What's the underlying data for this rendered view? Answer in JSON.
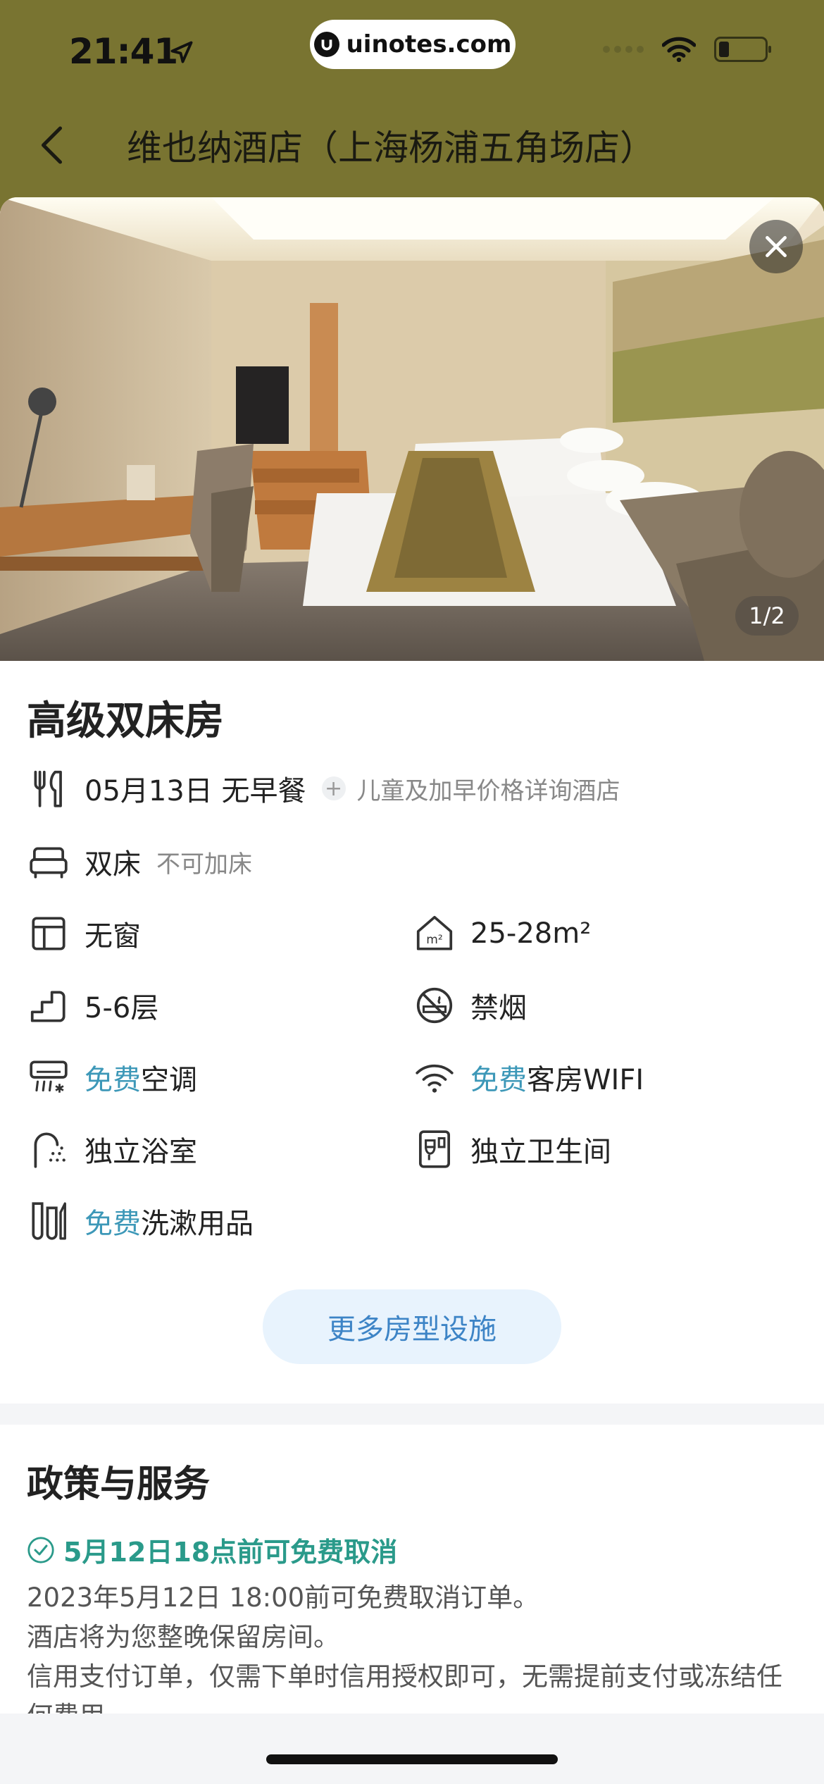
{
  "status_bar": {
    "time": "21:41",
    "url": "uinotes.com"
  },
  "header": {
    "title": "维也纳酒店（上海杨浦五角场店）"
  },
  "photo": {
    "counter": "1/2"
  },
  "room": {
    "name": "高级双床房",
    "meal": {
      "date_meal": "05月13日 无早餐",
      "note": "儿童及加早价格详询酒店"
    },
    "bed": {
      "type": "双床",
      "note": "不可加床"
    },
    "facilities": {
      "window": "无窗",
      "area": "25-28m²",
      "floor": "5-6层",
      "smoking": "禁烟",
      "free_label": "免费",
      "ac": "空调",
      "wifi": "客房WIFI",
      "bathroom": "独立浴室",
      "toilet": "独立卫生间",
      "toiletries": "洗漱用品"
    },
    "more_button": "更多房型设施"
  },
  "policy": {
    "title": "政策与服务",
    "cancel_headline": "5月12日18点前可免费取消",
    "lines": [
      "2023年5月12日 18:00前可免费取消订单。",
      "酒店将为您整晚保留房间。",
      "信用支付订单，仅需下单时信用授权即可，无需提前支付或冻结任何费用。"
    ]
  },
  "colors": {
    "header_bg": "#797431",
    "free_accent": "#3d98b8",
    "cancel_green": "#2a9a8a",
    "more_button_bg": "#e8f3fd"
  },
  "icons": [
    "location-arrow-icon",
    "wifi-icon",
    "battery-icon",
    "back-chevron-icon",
    "close-icon",
    "utensils-icon",
    "bed-icon",
    "window-icon",
    "area-icon",
    "floor-stairs-icon",
    "no-smoking-icon",
    "air-conditioner-icon",
    "wifi-room-icon",
    "shower-icon",
    "toilet-icon",
    "toiletries-icon",
    "check-circle-icon"
  ]
}
